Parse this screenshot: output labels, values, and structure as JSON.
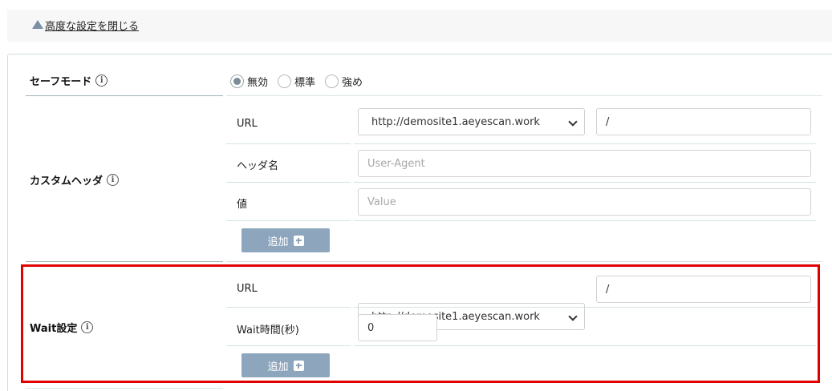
{
  "advanced_toggle": {
    "label": "高度な設定を閉じる"
  },
  "safe_mode": {
    "label": "セーフモード",
    "options": [
      {
        "label": "無効",
        "checked": true
      },
      {
        "label": "標準",
        "checked": false
      },
      {
        "label": "強め",
        "checked": false
      }
    ]
  },
  "custom_header": {
    "label": "カスタムヘッダ",
    "url_label": "URL",
    "url_select_value": "http://demosite1.aeyescan.work",
    "path_value": "/",
    "header_name_label": "ヘッダ名",
    "header_name_placeholder": "User-Agent",
    "value_label": "値",
    "value_placeholder": "Value",
    "add_button": "追加"
  },
  "wait_settings": {
    "label": "Wait設定",
    "url_label": "URL",
    "url_select_value": "http://demosite1.aeyescan.work",
    "path_value": "/",
    "wait_time_label": "Wait時間(秒)",
    "wait_time_value": "0",
    "add_button": "追加"
  },
  "colors": {
    "accent_button": "#8ea6bd",
    "highlight_border": "#e00000"
  }
}
